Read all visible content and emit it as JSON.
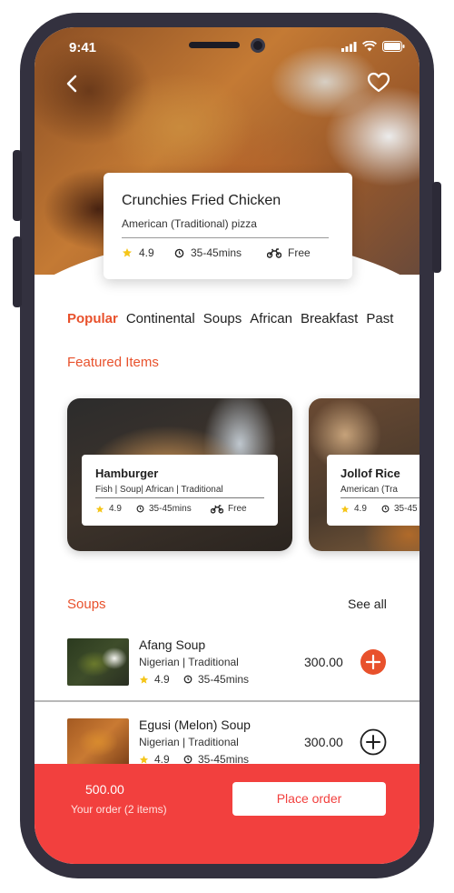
{
  "status_bar": {
    "time": "9:41"
  },
  "restaurant": {
    "name": "Crunchies Fried Chicken",
    "subtitle": "American (Traditional) pizza",
    "rating": "4.9",
    "delivery_time": "35-45mins",
    "delivery_fee": "Free"
  },
  "categories": [
    "Popular",
    "Continental",
    "Soups",
    "African",
    "Breakfast",
    "Past"
  ],
  "featured": {
    "title": "Featured Items",
    "items": [
      {
        "name": "Hamburger",
        "tags": "Fish | Soup| African | Traditional",
        "rating": "4.9",
        "time": "35-45mins",
        "fee": "Free"
      },
      {
        "name": "Jollof Rice",
        "tags": "American (Tra",
        "rating": "4.9",
        "time": "35-45"
      }
    ]
  },
  "soups": {
    "title": "Soups",
    "see_all": "See all",
    "items": [
      {
        "name": "Afang Soup",
        "tags": "Nigerian | Traditional",
        "rating": "4.9",
        "time": "35-45mins",
        "price": "300.00",
        "added": true
      },
      {
        "name": "Egusi (Melon) Soup",
        "tags": "Nigerian | Traditional",
        "rating": "4.9",
        "time": "35-45mins",
        "price": "300.00",
        "added": false
      }
    ]
  },
  "order": {
    "total": "500.00",
    "count_label": "Your order (2 items)",
    "button_label": "Place order"
  },
  "colors": {
    "accent": "#e8512c",
    "order_bar": "#f2403e",
    "star": "#f5c518"
  },
  "icons": [
    "back-chevron-icon",
    "heart-icon",
    "star-icon",
    "clock-icon",
    "motorbike-icon",
    "plus-icon",
    "signal-icon",
    "wifi-icon",
    "battery-icon"
  ]
}
